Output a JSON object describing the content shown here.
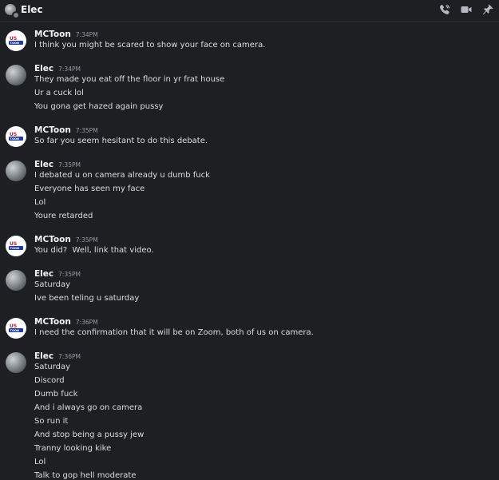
{
  "header": {
    "title": "Elec",
    "icons": [
      "call-icon",
      "video-icon",
      "pin-icon"
    ]
  },
  "messages": [
    {
      "author": "MCToon",
      "time": "7:34PM",
      "lines": [
        "I think you might be scared to show your face on camera."
      ]
    },
    {
      "author": "Elec",
      "time": "7:34PM",
      "lines": [
        "They made you eat off the floor in yr frat house",
        "Ur a cuck lol",
        "You gona get hazed again pussy"
      ]
    },
    {
      "author": "MCToon",
      "time": "7:35PM",
      "lines": [
        "So far you seem hesitant to do this debate."
      ]
    },
    {
      "author": "Elec",
      "time": "7:35PM",
      "lines": [
        "I debated u on camera already u dumb fuck",
        "Everyone has seen my face",
        "Lol",
        "Youre retarded"
      ]
    },
    {
      "author": "MCToon",
      "time": "7:35PM",
      "lines": [
        "You did?  Well, link that video."
      ]
    },
    {
      "author": "Elec",
      "time": "7:35PM",
      "lines": [
        "Saturday",
        "Ive been teling u saturday"
      ]
    },
    {
      "author": "MCToon",
      "time": "7:36PM",
      "lines": [
        "I need the confirmation that it will be on Zoom, both of us on camera."
      ]
    },
    {
      "author": "Elec",
      "time": "7:36PM",
      "lines": [
        "Saturday",
        "Discord",
        "Dumb fuck",
        "And i always go on camera",
        "So run it",
        "And stop being a pussy jew",
        "Tranny looking kike",
        "Lol",
        "Talk to gop hell moderate"
      ]
    }
  ]
}
